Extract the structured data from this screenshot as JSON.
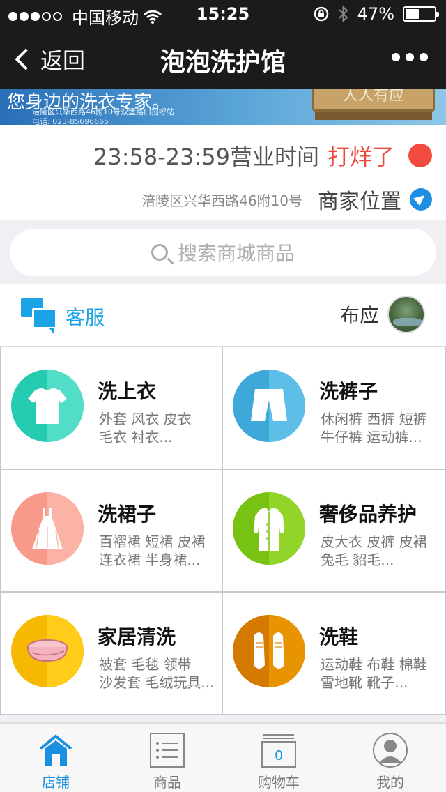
{
  "status_bar": {
    "carrier": "中国移动",
    "time": "15:25",
    "battery": "47%",
    "battery_level": 0.47
  },
  "nav": {
    "back_label": "返回",
    "title": "泡泡洗护馆"
  },
  "banner": {
    "slogan": "您身边的洗衣专家。",
    "address": "涪陵区兴华西路46附10号双堡路口招呼站",
    "phone": "电话: 023-85696665",
    "sign": "人人有应"
  },
  "store": {
    "hours": "23:58-23:59营业时间",
    "status": "打烊了",
    "address": "涪陵区兴华西路46附10号",
    "location_label": "商家位置"
  },
  "search": {
    "placeholder": "搜索商城商品"
  },
  "service": {
    "customer_service": "客服",
    "owner_name": "布应"
  },
  "categories": [
    {
      "title": "洗上衣",
      "line1": "外套 风衣 皮衣",
      "line2": "毛衣 衬衣...",
      "icon": "shirt-icon",
      "color_left": "#25cbb0",
      "color_right": "#52ddc8"
    },
    {
      "title": "洗裤子",
      "line1": "休闲裤 西裤 短裤",
      "line2": "牛仔裤 运动裤...",
      "icon": "shorts-icon",
      "color_left": "#3ea8d8",
      "color_right": "#5dbfe8"
    },
    {
      "title": "洗裙子",
      "line1": "百褶裙 短裙 皮裙",
      "line2": "连衣裙 半身裙...",
      "icon": "dress-icon",
      "color_left": "#f89a8a",
      "color_right": "#fbb3a6"
    },
    {
      "title": "奢侈品养护",
      "line1": "皮大衣 皮裤 皮裙",
      "line2": "兔毛 貂毛...",
      "icon": "coat-icon",
      "color_left": "#78c214",
      "color_right": "#93d42a"
    },
    {
      "title": "家居清洗",
      "line1": "被套 毛毯 领带",
      "line2": "沙发套 毛绒玩具...",
      "icon": "towel-icon",
      "color_left": "#f6b800",
      "color_right": "#ffcc1a"
    },
    {
      "title": "洗鞋",
      "line1": "运动鞋 布鞋 棉鞋",
      "line2": "雪地靴 靴子...",
      "icon": "shoes-icon",
      "color_left": "#d47a00",
      "color_right": "#e89400"
    }
  ],
  "tabs": [
    {
      "label": "店铺",
      "icon": "home-icon",
      "active": true
    },
    {
      "label": "商品",
      "icon": "list-icon",
      "active": false
    },
    {
      "label": "购物车",
      "icon": "cart-icon",
      "count": "0",
      "active": false
    },
    {
      "label": "我的",
      "icon": "user-icon",
      "active": false
    }
  ],
  "colors": {
    "accent": "#1a8fe0",
    "closed_red": "#ec4a3c"
  }
}
